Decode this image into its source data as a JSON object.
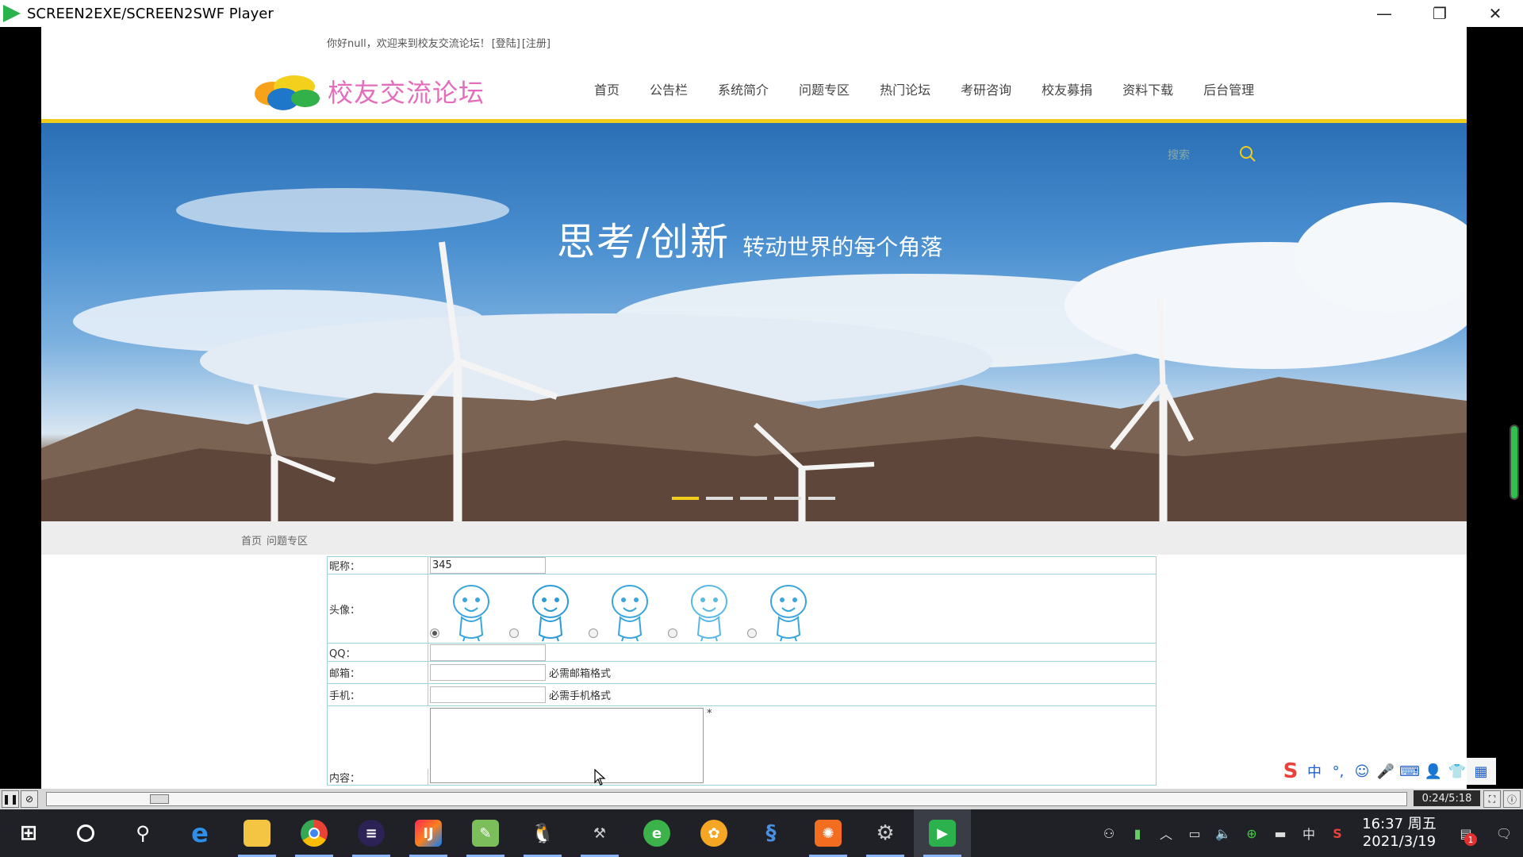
{
  "window": {
    "title": "SCREEN2EXE/SCREEN2SWF Player",
    "controls": [
      "—",
      "❐",
      "✕"
    ]
  },
  "site": {
    "topbar": {
      "greeting": "你好null，欢迎来到校友交流论坛！",
      "login": "[登陆]",
      "register": "[注册]"
    },
    "logo_text": "校友交流论坛",
    "nav": [
      "首页",
      "公告栏",
      "系统简介",
      "问题专区",
      "热门论坛",
      "考研咨询",
      "校友募捐",
      "资料下载",
      "后台管理"
    ],
    "banner": {
      "headline": "思考/创新",
      "subline": "转动世界的每个角落",
      "search_label": "搜索",
      "slide_count": 5,
      "active_slide": 0,
      "colors": {
        "active_dot": "#f0cc1c"
      }
    },
    "breadcrumb": [
      "首页",
      "问题专区"
    ],
    "form": {
      "nickname_label": "昵称：",
      "nickname_value": "345",
      "avatar_label": "头像：",
      "avatar_count": 5,
      "avatar_selected": 0,
      "qq_label": "QQ：",
      "qq_value": "",
      "email_label": "邮箱：",
      "email_value": "",
      "email_hint": "必需邮箱格式",
      "phone_label": "手机：",
      "phone_value": "",
      "phone_hint": "必需手机格式",
      "content_label": "内容：",
      "content_marker": "*"
    }
  },
  "ime": {
    "logo": "S",
    "items": [
      "中",
      "°,",
      "☺",
      "🎤",
      "⌨",
      "👤",
      "👕",
      "▦"
    ]
  },
  "player": {
    "time": "0:24/5:18",
    "progress_fraction": 0.077
  },
  "taskbar": {
    "icons": [
      "windows-start",
      "cortana",
      "search",
      "edge",
      "file-explorer",
      "chrome",
      "eclipse",
      "intellij",
      "notepad",
      "qq",
      "tools",
      "browser-360",
      "sunflower",
      "feather",
      "photo-app",
      "settings-gear",
      "screen2swf-player"
    ],
    "clock_time": "16:37 周五",
    "clock_date": "2021/3/19",
    "lang": "中",
    "notification_count": "1"
  }
}
